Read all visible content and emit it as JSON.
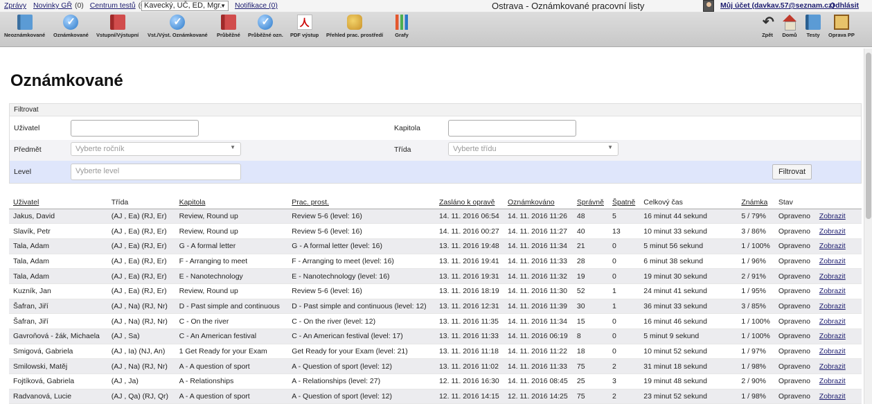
{
  "topbar": {
    "links": [
      {
        "label": "Zprávy",
        "count": ""
      },
      {
        "label": "Novinky GŘ",
        "count": "(0)"
      },
      {
        "label": "Centrum testů",
        "count": "(0)"
      }
    ],
    "user_select": "Kavecký, UČ, ED, Mgr.",
    "notifications": "Notifikace (0)",
    "title": "Ostrava - Oznámkované pracovní listy",
    "account": "Můj účet (davkav.57@seznam.cz)",
    "logout": "Odhlásit"
  },
  "toolbar": {
    "items": [
      {
        "label": "Neoznámkované",
        "icon": "book-icon"
      },
      {
        "label": "Oznámkované",
        "icon": "check-icon"
      },
      {
        "label": "Vstupní/Výstupní",
        "icon": "red-book-icon"
      },
      {
        "label": "Vst./Výst. Oznámkované",
        "icon": "check-icon"
      },
      {
        "label": "Průběžné",
        "icon": "red-book-icon"
      },
      {
        "label": "Průběžné ozn.",
        "icon": "check-icon"
      },
      {
        "label": "PDF výstup",
        "icon": "pdf-icon"
      },
      {
        "label": "Přehled prac. prostředí",
        "icon": "users-icon"
      },
      {
        "label": "Grafy",
        "icon": "bar-chart-icon"
      }
    ],
    "right_items": [
      {
        "label": "Zpět",
        "icon": "back-arrow-icon"
      },
      {
        "label": "Domů",
        "icon": "home-icon"
      },
      {
        "label": "Testy",
        "icon": "book-icon"
      },
      {
        "label": "Oprava PP",
        "icon": "correction-icon"
      }
    ]
  },
  "page": {
    "title": "Oznámkované"
  },
  "filter": {
    "header": "Filtrovat",
    "user_label": "Uživatel",
    "user_value": "",
    "chapter_label": "Kapitola",
    "chapter_value": "",
    "subject_label": "Předmět",
    "subject_placeholder": "Vyberte ročník",
    "class_label": "Třída",
    "class_placeholder": "Vyberte třídu",
    "level_label": "Level",
    "level_placeholder": "Vyberte level",
    "button": "Filtrovat"
  },
  "table": {
    "headers": [
      "Uživatel",
      "Třída",
      "Kapitola",
      "Prac. prost.",
      "Zasláno k opravě",
      "Oznámkováno",
      "Správně",
      "Špatně",
      "Celkový čas",
      "Známka",
      "Stav",
      ""
    ],
    "link_label": "Zobrazit",
    "rows": [
      [
        "Jakus, David",
        "(AJ , Ea) (RJ, Er)",
        "Review, Round up",
        "Review 5-6 (level: 16)",
        "14. 11. 2016 06:54",
        "14. 11. 2016 11:26",
        "48",
        "5",
        "16 minut 44 sekund",
        "5 / 79%",
        "Opraveno"
      ],
      [
        "Slavík, Petr",
        "(AJ , Ea) (RJ, Er)",
        "Review, Round up",
        "Review 5-6 (level: 16)",
        "14. 11. 2016 00:27",
        "14. 11. 2016 11:27",
        "40",
        "13",
        "10 minut 33 sekund",
        "3 / 86%",
        "Opraveno"
      ],
      [
        "Tala, Adam",
        "(AJ , Ea) (RJ, Er)",
        "G - A formal letter",
        "G - A formal letter (level: 16)",
        "13. 11. 2016 19:48",
        "14. 11. 2016 11:34",
        "21",
        "0",
        "5 minut 56 sekund",
        "1 / 100%",
        "Opraveno"
      ],
      [
        "Tala, Adam",
        "(AJ , Ea) (RJ, Er)",
        "F - Arranging to meet",
        "F - Arranging to meet (level: 16)",
        "13. 11. 2016 19:41",
        "14. 11. 2016 11:33",
        "28",
        "0",
        "6 minut 38 sekund",
        "1 / 96%",
        "Opraveno"
      ],
      [
        "Tala, Adam",
        "(AJ , Ea) (RJ, Er)",
        "E - Nanotechnology",
        "E - Nanotechnology (level: 16)",
        "13. 11. 2016 19:31",
        "14. 11. 2016 11:32",
        "19",
        "0",
        "19 minut 30 sekund",
        "2 / 91%",
        "Opraveno"
      ],
      [
        "Kuzník, Jan",
        "(AJ , Ea) (RJ, Er)",
        "Review, Round up",
        "Review 5-6 (level: 16)",
        "13. 11. 2016 18:19",
        "14. 11. 2016 11:30",
        "52",
        "1",
        "24 minut 41 sekund",
        "1 / 95%",
        "Opraveno"
      ],
      [
        "Šafran, Jiří",
        "(AJ , Na) (RJ, Nr)",
        "D - Past simple and continuous",
        "D - Past simple and continuous (level: 12)",
        "13. 11. 2016 12:31",
        "14. 11. 2016 11:39",
        "30",
        "1",
        "36 minut 33 sekund",
        "3 / 85%",
        "Opraveno"
      ],
      [
        "Šafran, Jiří",
        "(AJ , Na) (RJ, Nr)",
        "C - On the river",
        "C - On the river (level: 12)",
        "13. 11. 2016 11:35",
        "14. 11. 2016 11:34",
        "15",
        "0",
        "16 minut 46 sekund",
        "1 / 100%",
        "Opraveno"
      ],
      [
        "Gavroňová - žák, Michaela",
        "(AJ , Sa)",
        "C - An American festival",
        "C - An American festival (level: 17)",
        "13. 11. 2016 11:33",
        "14. 11. 2016 06:19",
        "8",
        "0",
        "5 minut 9 sekund",
        "1 / 100%",
        "Opraveno"
      ],
      [
        "Smigová, Gabriela",
        "(AJ , Ia) (NJ, An)",
        "1 Get Ready for your Exam",
        "Get Ready for your Exam (level: 21)",
        "13. 11. 2016 11:18",
        "14. 11. 2016 11:22",
        "18",
        "0",
        "10 minut 52 sekund",
        "1 / 97%",
        "Opraveno"
      ],
      [
        "Smilowski, Matěj",
        "(AJ , Na) (RJ, Nr)",
        "A - A question of sport",
        "A - Question of sport (level: 12)",
        "13. 11. 2016 11:02",
        "14. 11. 2016 11:33",
        "75",
        "2",
        "31 minut 18 sekund",
        "1 / 98%",
        "Opraveno"
      ],
      [
        "Fojtíková, Gabriela",
        "(AJ , Ja)",
        "A - Relationships",
        "A - Relationships (level: 27)",
        "12. 11. 2016 16:30",
        "14. 11. 2016 08:45",
        "25",
        "3",
        "19 minut 48 sekund",
        "2 / 90%",
        "Opraveno"
      ],
      [
        "Radvanová, Lucie",
        "(AJ , Qa) (RJ, Qr)",
        "A - A question of sport",
        "A - Question of sport (level: 12)",
        "12. 11. 2016 14:15",
        "12. 11. 2016 14:25",
        "75",
        "2",
        "23 minut 52 sekund",
        "1 / 98%",
        "Opraveno"
      ]
    ]
  }
}
